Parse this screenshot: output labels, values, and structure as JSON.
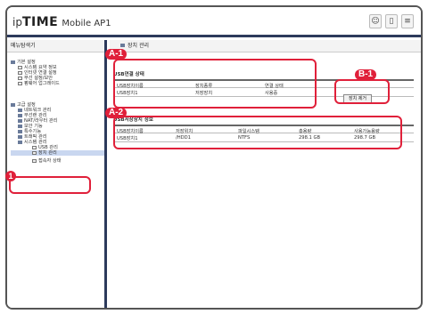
{
  "header": {
    "logo_ip": "ip",
    "logo_time": "TIME",
    "logo_model": "Mobile AP1",
    "icons": [
      "user-icon",
      "mobile-icon",
      "help-icon"
    ]
  },
  "sidebar": {
    "title": "메뉴탐색기",
    "basic": {
      "label": "기본 설정",
      "items": [
        "시스템 요약 정보",
        "인터넷 연결 설정",
        "무선 설정/보안",
        "펌웨어 업그레이드"
      ]
    },
    "advanced": {
      "label": "고급 설정",
      "items": [
        "네트워크 관리",
        "무선랜 관리",
        "NAT/라우터 관리",
        "보안 기능",
        "특수기능",
        "트래픽 관리",
        "시스템 관리"
      ],
      "subitems": [
        "USB 관리",
        "장치 관리",
        "접속자 상태"
      ]
    }
  },
  "main": {
    "title": "장치 관리",
    "usb_status": {
      "title": "USB연결 상태",
      "headers": [
        "USB장치이름",
        "장치종류",
        "연결 상태"
      ],
      "rows": [
        [
          "USB장치1",
          "저장장치",
          "사용중"
        ]
      ],
      "remove_button": "장치 제거"
    },
    "storage_info": {
      "title": "USB저장장치 정보",
      "headers": [
        "USB장치이름",
        "저장위치",
        "파일시스템",
        "총용량",
        "사용가능용량"
      ],
      "rows": [
        [
          "USB장치1",
          "/HDD1",
          "NTFS",
          "298.1 GB",
          "298.7 GB"
        ]
      ]
    }
  },
  "annotations": {
    "a1": "A-1",
    "a2": "A-2",
    "b1": "B-1",
    "step1": "1"
  }
}
